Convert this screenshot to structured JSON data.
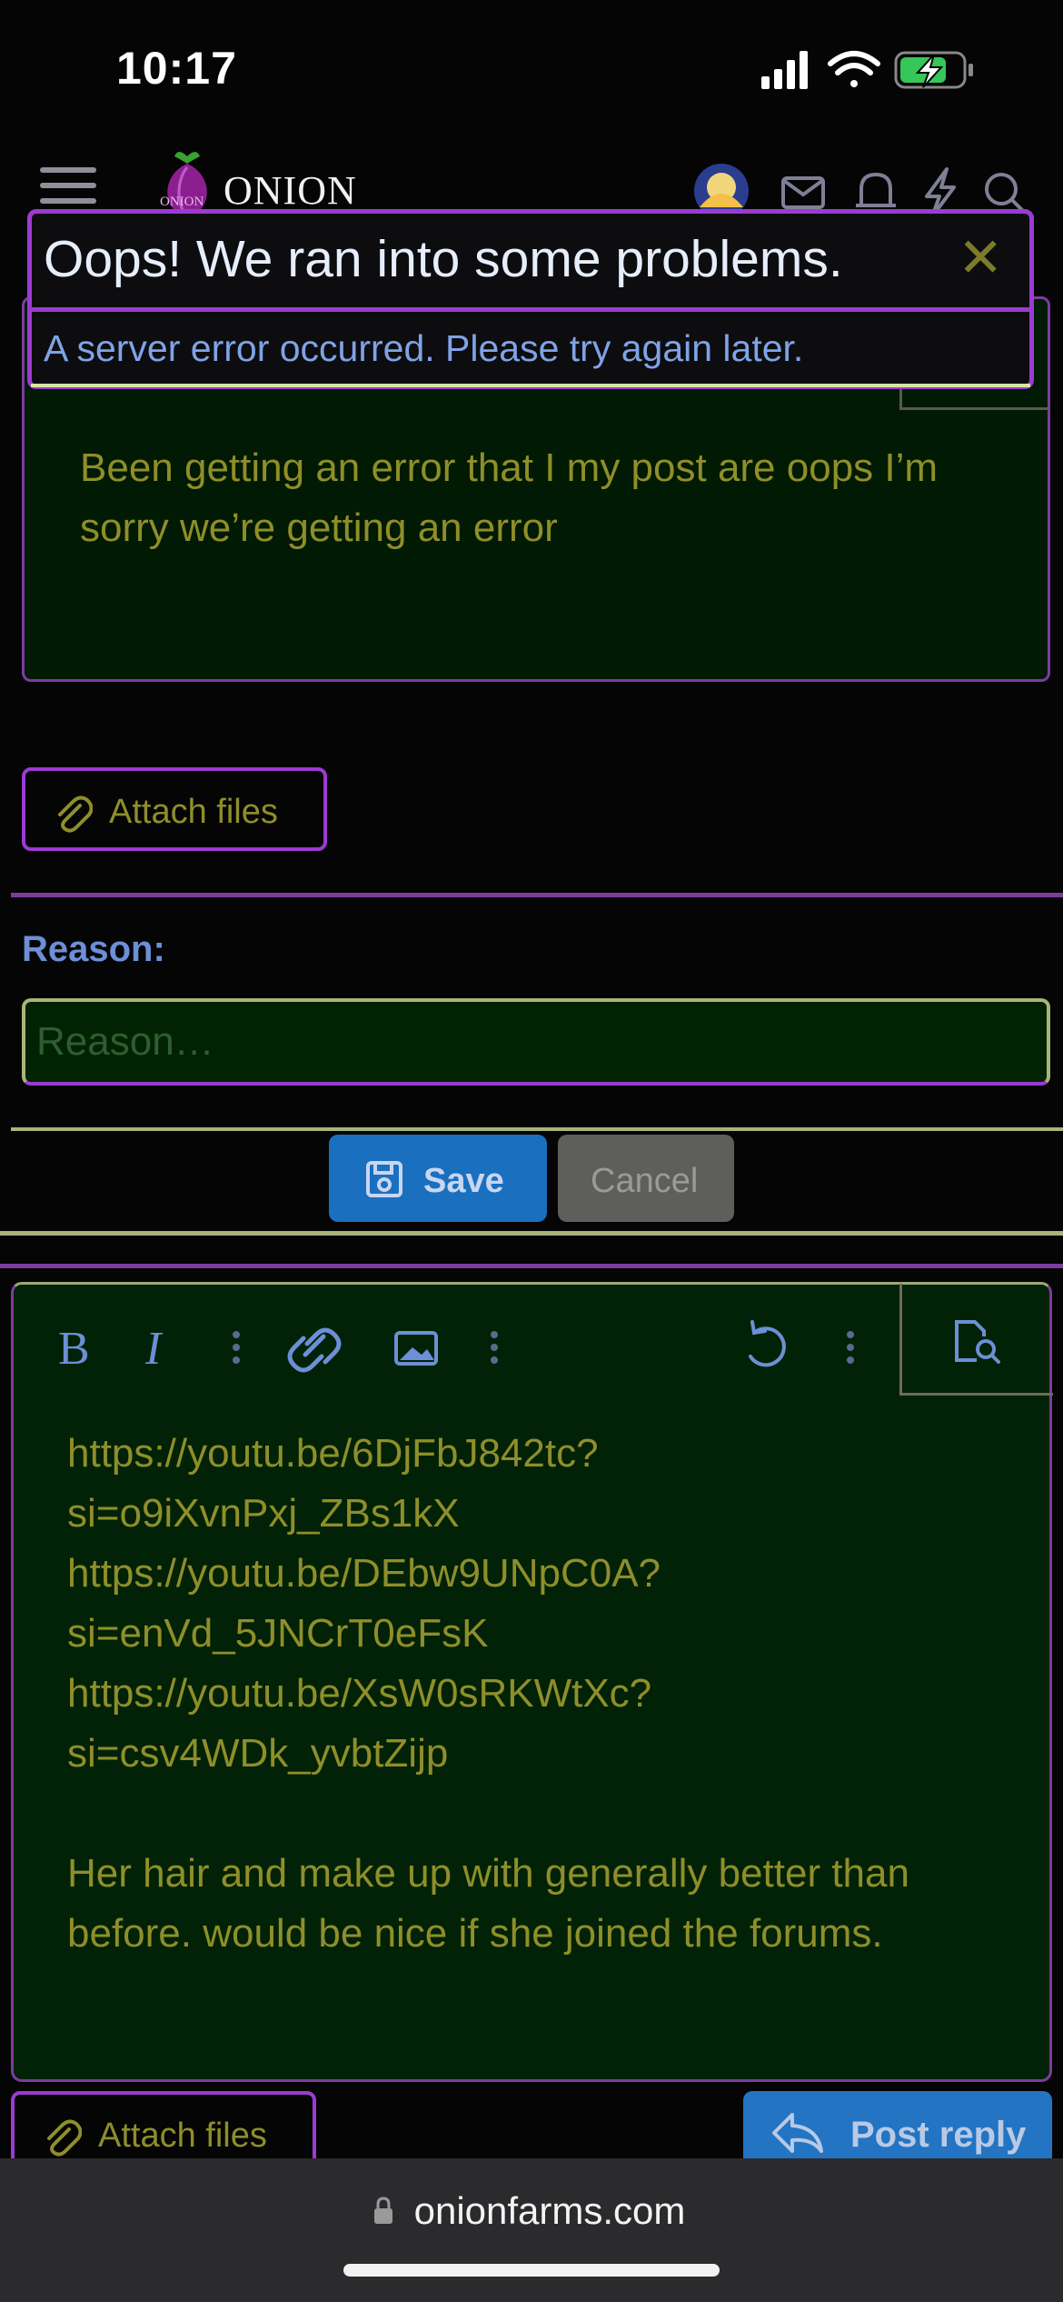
{
  "status_bar": {
    "time": "10:17"
  },
  "header": {
    "logo_text": "ONION",
    "logo_small": "ONION"
  },
  "error": {
    "title": "Oops! We ran into some problems.",
    "message": "A server error occurred. Please try again later.",
    "close_glyph": "✕"
  },
  "editor1": {
    "text": "Been getting an error that I my post are oops I’m sorry we’re getting an error"
  },
  "attach1": {
    "label": "Attach files"
  },
  "reason": {
    "label": "Reason:",
    "placeholder": "Reason…"
  },
  "actions": {
    "save_label": "Save",
    "cancel_label": "Cancel"
  },
  "editor2": {
    "text": "https://youtu.be/6DjFbJ842tc?\nsi=o9iXvnPxj_ZBs1kX\nhttps://youtu.be/DEbw9UNpC0A?\nsi=enVd_5JNCrT0eFsK\nhttps://youtu.be/XsW0sRKWtXc?\nsi=csv4WDk_yvbtZijp\n\nHer hair and make up with generally better than before. would be nice if she joined the forums."
  },
  "attach2": {
    "label": "Attach files"
  },
  "post_reply": {
    "label": "Post reply"
  },
  "browser": {
    "url": "onionfarms.com"
  },
  "colors": {
    "accent_purple": "#9b3bd2",
    "editor_green": "#012206",
    "text_olive": "#8f8e2a",
    "link_blue": "#1b6fbf"
  }
}
